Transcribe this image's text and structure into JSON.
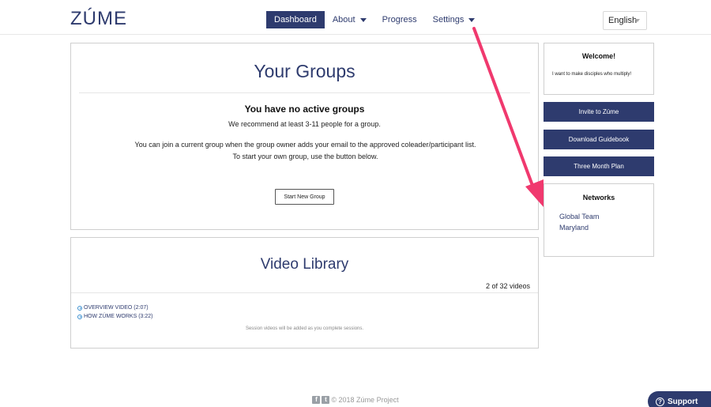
{
  "header": {
    "logo": "ZÚME",
    "nav": [
      {
        "label": "Dashboard"
      },
      {
        "label": "About"
      },
      {
        "label": "Progress"
      },
      {
        "label": "Settings"
      }
    ],
    "language": "English"
  },
  "groups": {
    "title": "Your Groups",
    "empty_heading": "You have no active groups",
    "recommend": "We recommend at least 3-11 people for a group.",
    "join_text": "You can join a current group when the group owner adds your email to the approved coleader/participant list. To start your own group, use the button below.",
    "start_button": "Start New Group"
  },
  "video_library": {
    "title": "Video Library",
    "count": "2 of 32 videos",
    "videos": [
      {
        "label": "OVERVIEW VIDEO (2:07)"
      },
      {
        "label": "HOW ZÚME WORKS (3:22)"
      }
    ],
    "note": "Session videos will be added as you complete sessions."
  },
  "sidebar": {
    "welcome_title": "Welcome!",
    "welcome_text": "I want to make disciples who multiply!",
    "buttons": [
      {
        "label": "Invite to Zúme"
      },
      {
        "label": "Download Guidebook"
      },
      {
        "label": "Three Month Plan"
      }
    ],
    "networks_title": "Networks",
    "networks": [
      {
        "label": "Global Team"
      },
      {
        "label": "Maryland"
      }
    ]
  },
  "footer": {
    "copyright": "© 2018 Zúme Project",
    "support": "Support"
  },
  "colors": {
    "brand": "#2e3b6e",
    "arrow": "#f0396e"
  }
}
